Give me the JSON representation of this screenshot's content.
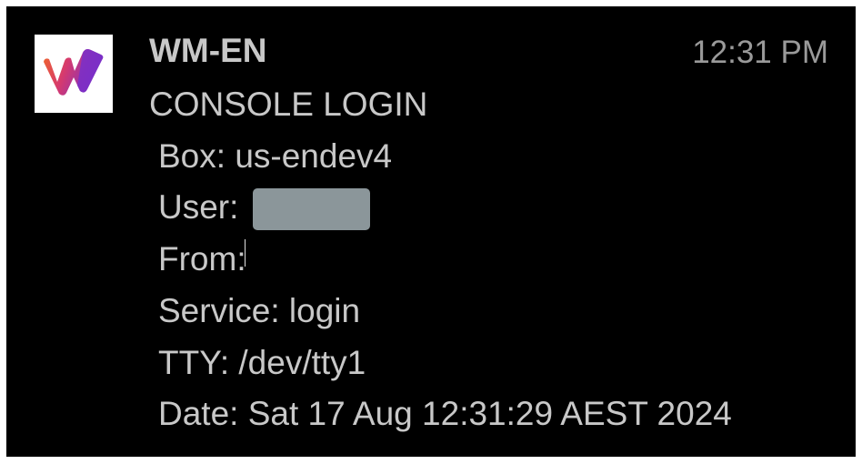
{
  "notification": {
    "app_icon": "app-logo-icon",
    "app_name": "WM-EN",
    "time": "12:31 PM",
    "title": "CONSOLE LOGIN",
    "lines": {
      "box": "Box: us-endev4",
      "user": "User:",
      "from": "From:",
      "service": "Service: login",
      "tty": "TTY: /dev/tty1",
      "date": "Date: Sat 17 Aug 12:31:29 AEST 2024"
    }
  },
  "colors": {
    "background": "#000000",
    "primary_text": "#c8c8c8",
    "time_text": "#9a9a9a",
    "redaction": "#8b969a",
    "icon_orange": "#f0662a",
    "icon_purple": "#7a2fc8"
  }
}
